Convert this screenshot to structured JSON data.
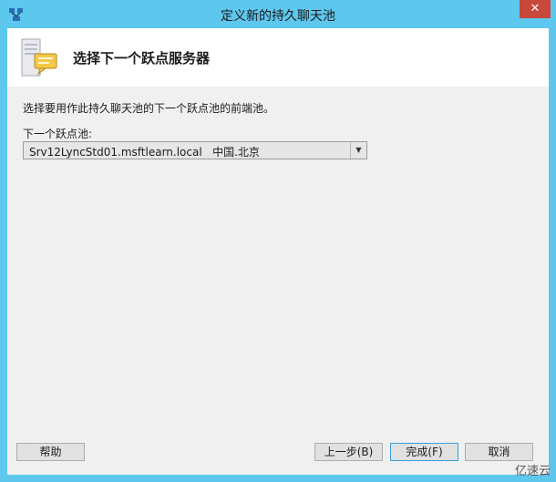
{
  "window": {
    "title": "定义新的持久聊天池",
    "close_label": "✕"
  },
  "header": {
    "title": "选择下一个跃点服务器"
  },
  "main": {
    "description": "选择要用作此持久聊天池的下一个跃点池的前端池。",
    "next_hop_label": "下一个跃点池:",
    "next_hop_value": "Srv12LyncStd01.msftlearn.local   中国.北京"
  },
  "buttons": {
    "help": "帮助",
    "back": "上一步(B)",
    "finish": "完成(F)",
    "cancel": "取消"
  },
  "watermark": "亿速云",
  "colors": {
    "title_bar": "#5dc7ee",
    "close_button": "#c7473a",
    "client_bg": "#f0f0f0",
    "header_bg": "#ffffff"
  }
}
